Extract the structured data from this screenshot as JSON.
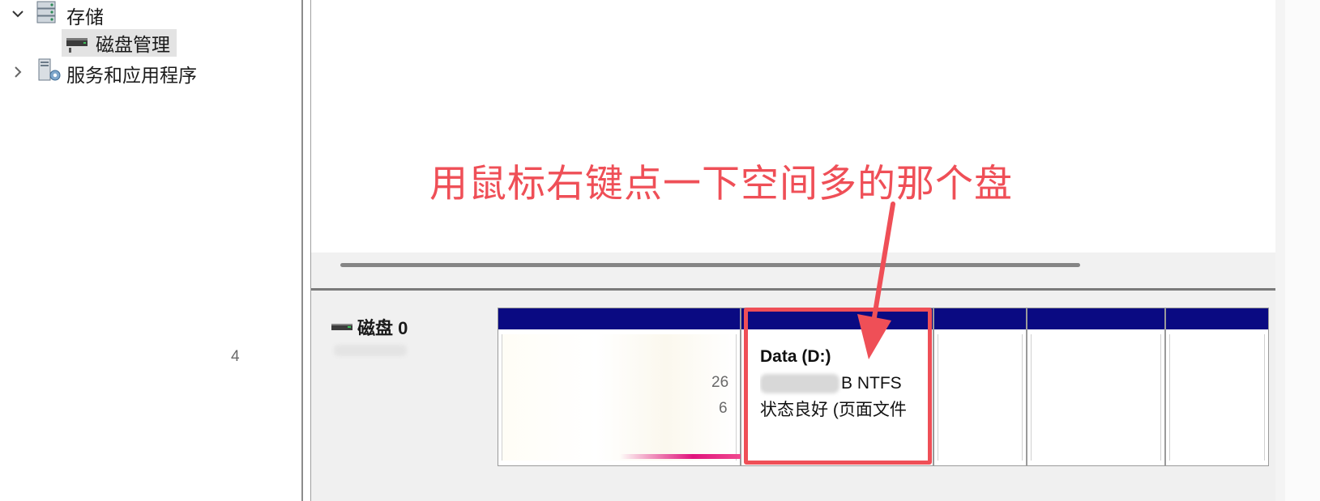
{
  "tree": {
    "storage_label": "存储",
    "disk_management_label": "磁盘管理",
    "services_label": "服务和应用程序"
  },
  "disk": {
    "name": "磁盘 0"
  },
  "partition_d": {
    "title": "Data  (D:)",
    "size_fragment": "B NTFS",
    "status": "状态良好 (页面文件"
  },
  "partition_1_fragments": [
    "4",
    "26",
    "6"
  ],
  "annotation": {
    "text": "用鼠标右键点一下空间多的那个盘",
    "color": "#ef4f57"
  },
  "colors": {
    "partition_bar": "#0a0a82",
    "selection_bg": "#e3e3e3"
  },
  "icons": [
    "chevron-down-icon",
    "storage-icon",
    "disk-icon",
    "chevron-right-icon",
    "services-icon",
    "arrow-icon"
  ]
}
